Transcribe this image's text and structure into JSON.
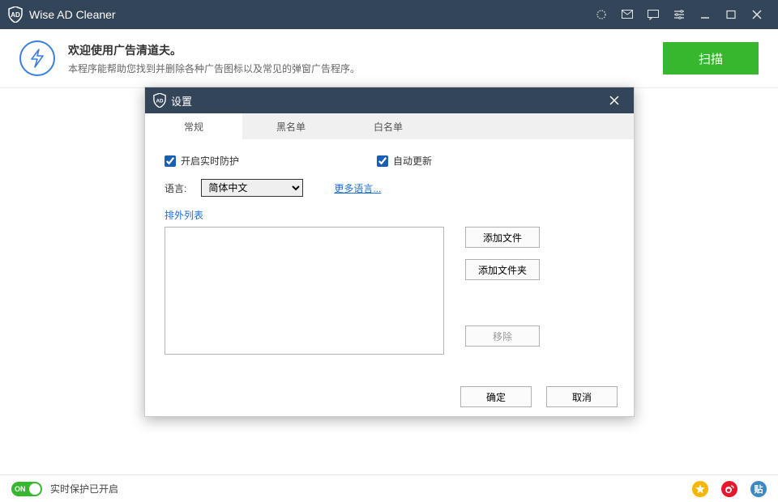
{
  "titlebar": {
    "title": "Wise AD Cleaner"
  },
  "header": {
    "welcome": "欢迎使用广告清道夫。",
    "desc": "本程序能帮助您找到并删除各种广告图标以及常见的弹窗广告程序。",
    "scan": "扫描"
  },
  "dialog": {
    "title": "设置",
    "tabs": {
      "general": "常规",
      "blacklist": "黑名单",
      "whitelist": "白名单"
    },
    "realtime": "开启实时防护",
    "autoupdate": "自动更新",
    "lang_label": "语言:",
    "lang_value": "简体中文",
    "more_lang": "更多语言...",
    "exclusion_label": "排外列表",
    "add_file": "添加文件",
    "add_folder": "添加文件夹",
    "remove": "移除",
    "ok": "确定",
    "cancel": "取消"
  },
  "status": {
    "toggle_text": "ON",
    "label": "实时保护已开启",
    "tie_glyph": "贴"
  }
}
